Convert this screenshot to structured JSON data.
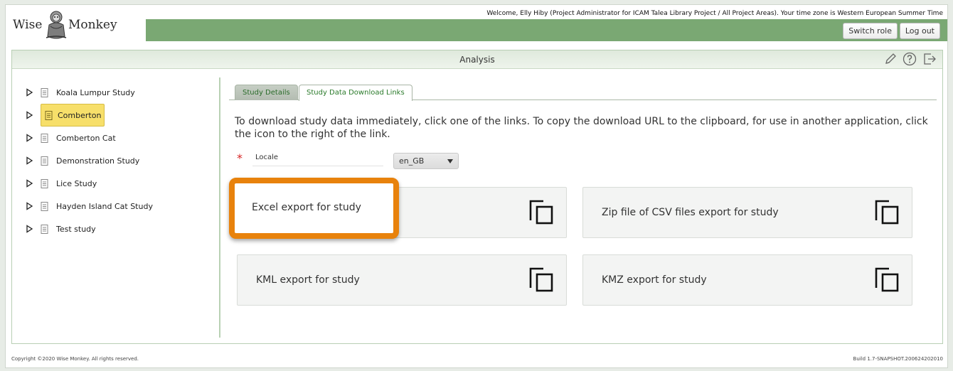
{
  "header": {
    "logo_left": "Wise",
    "logo_right": "Monkey",
    "welcome": "Welcome, Elly Hiby (Project Administrator for ICAM Talea Library Project / All Project Areas). Your time zone is Western European Summer Time",
    "switch_role": "Switch role",
    "log_out": "Log out",
    "brand_color": "#7aa873"
  },
  "panel": {
    "title": "Analysis",
    "icons": [
      "pencil-icon",
      "help-icon",
      "exit-icon"
    ]
  },
  "sidebar": {
    "items": [
      {
        "label": "Koala Lumpur Study",
        "selected": false
      },
      {
        "label": "Comberton",
        "selected": true
      },
      {
        "label": "Comberton Cat",
        "selected": false
      },
      {
        "label": "Demonstration Study",
        "selected": false
      },
      {
        "label": "Lice Study",
        "selected": false
      },
      {
        "label": "Hayden Island Cat Study",
        "selected": false
      },
      {
        "label": "Test study",
        "selected": false
      }
    ]
  },
  "tabs": [
    {
      "label": "Study Details",
      "active": false
    },
    {
      "label": "Study Data Download Links",
      "active": true
    }
  ],
  "main": {
    "instructions": "To download study data immediately, click one of the links. To copy the download URL to the clipboard, for use in another application, click the icon to the right of the link.",
    "locale_label": "Locale",
    "locale_value": "en_GB",
    "exports": [
      {
        "label": "Excel export for study",
        "highlighted": true
      },
      {
        "label": "Zip file of CSV files export for study",
        "highlighted": false
      },
      {
        "label": "KML export for study",
        "highlighted": false
      },
      {
        "label": "KMZ export for study",
        "highlighted": false
      }
    ],
    "highlight_color": "#e8820c"
  },
  "footer": {
    "copyright": "Copyright ©2020 Wise Monkey. All rights reserved.",
    "build": "Build 1.7-SNAPSHOT.200624202010"
  }
}
